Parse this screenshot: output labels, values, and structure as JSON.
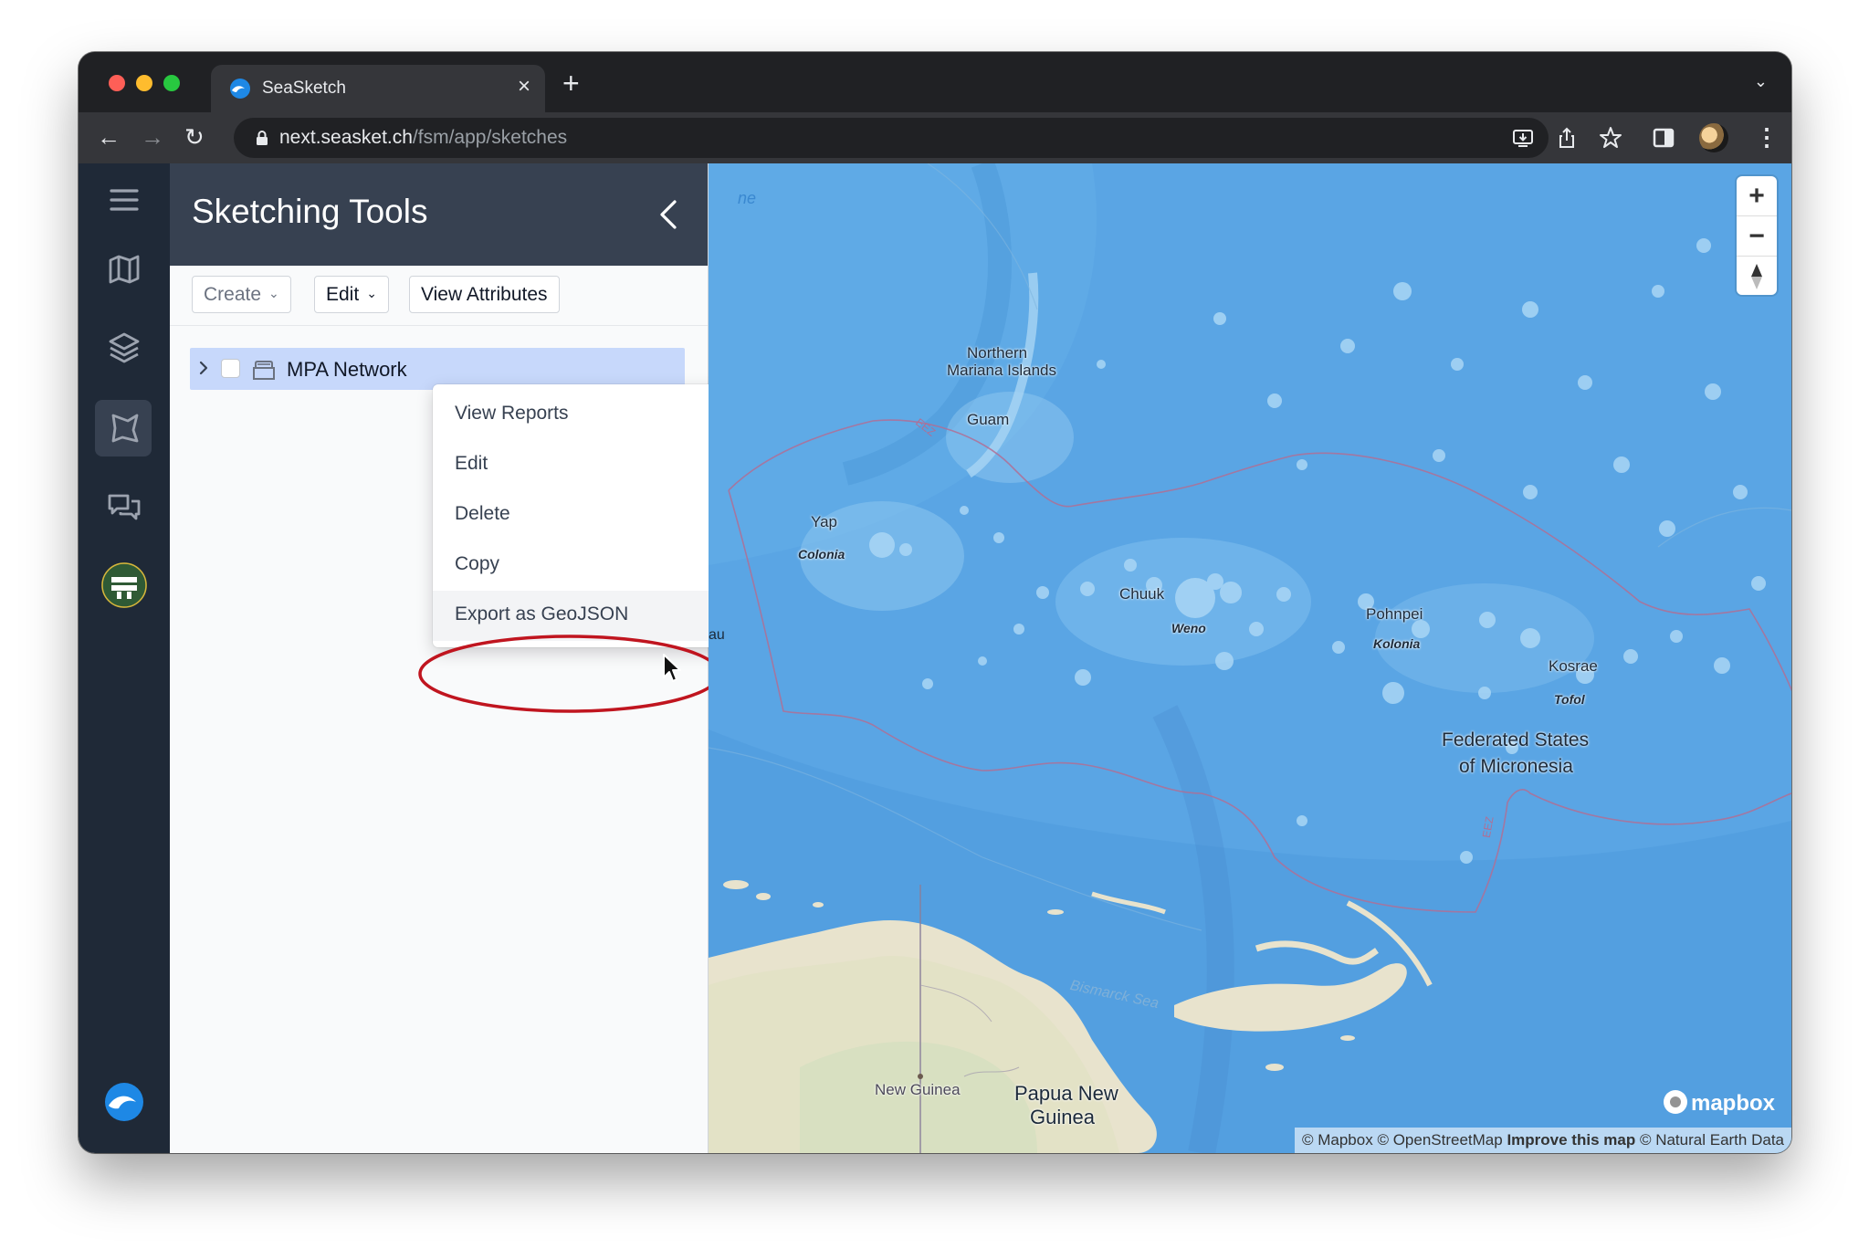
{
  "browser": {
    "tab_title": "SeaSketch",
    "url_host": "next.seasket.ch",
    "url_path": "/fsm/app/sketches"
  },
  "panel": {
    "title": "Sketching Tools",
    "toolbar": {
      "create_label": "Create",
      "edit_label": "Edit",
      "view_attributes_label": "View Attributes"
    },
    "tree": [
      {
        "label": "MPA Network",
        "type": "collection",
        "selected": true,
        "checked": false,
        "expanded": false
      }
    ]
  },
  "context_menu": {
    "items": [
      {
        "label": "View Reports"
      },
      {
        "label": "Edit"
      },
      {
        "label": "Delete"
      },
      {
        "label": "Copy"
      },
      {
        "label": "Export as GeoJSON",
        "highlighted": true
      }
    ]
  },
  "map": {
    "labels": {
      "northern_mariana": "Northern",
      "northern_mariana_2": "Mariana Islands",
      "guam": "Guam",
      "yap": "Yap",
      "colonia": "Colonia",
      "chuuk": "Chuuk",
      "weno": "Weno",
      "pohnpei": "Pohnpei",
      "kolonia": "Kolonia",
      "kosrae": "Kosrae",
      "tofol": "Tofol",
      "fsm_1": "Federated States",
      "fsm_2": "of Micronesia",
      "eez_1": "EEZ",
      "eez_2": "EEZ",
      "bismarck": "Bismarck Sea",
      "new_guinea": "New Guinea",
      "png_1": "Papua New",
      "png_2": "Guinea",
      "edge_au": "au",
      "edge_ne": "ne"
    },
    "zoom_in": "+",
    "zoom_out": "−",
    "logo": "mapbox",
    "attribution": {
      "a": "© Mapbox",
      "b": "© OpenStreetMap",
      "improve": "Improve this map",
      "c": "© Natural Earth Data"
    }
  },
  "colors": {
    "rail_bg": "#1f2937",
    "header_bg": "#374151",
    "selected_row": "#c7d8fb",
    "annotation": "#c0151f",
    "ocean": "#5ea8e6",
    "land": "#e7e3cf"
  }
}
